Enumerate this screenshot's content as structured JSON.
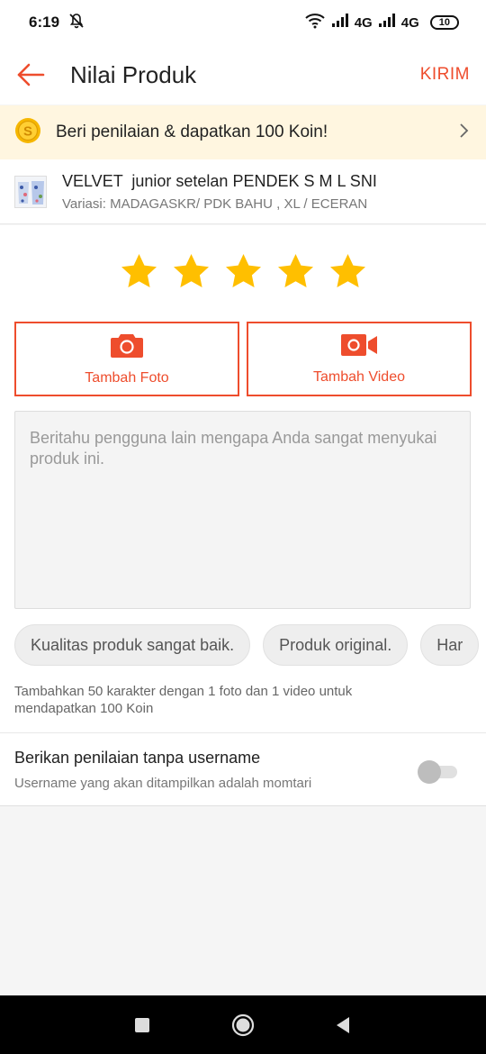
{
  "status_bar": {
    "time": "6:19",
    "network_1": "4G",
    "network_2": "4G",
    "battery": "10",
    "icons": [
      "mute-icon",
      "wifi-icon",
      "signal-icon",
      "battery-icon"
    ]
  },
  "app_bar": {
    "title": "Nilai Produk",
    "submit_label": "KIRIM",
    "back_icon": "back-arrow-icon"
  },
  "coin_banner": {
    "text": "Beri penilaian & dapatkan 100 Koin!",
    "coin_symbol": "S",
    "icon": "coin-icon"
  },
  "product": {
    "name": "VELVET  junior setelan PENDEK S M L SNI",
    "variant": "Variasi: MADAGASKR/ PDK BAHU , XL / ECERAN"
  },
  "rating": {
    "stars": 5,
    "max": 5,
    "color": "#ffbf00"
  },
  "media": {
    "photo_label": "Tambah Foto",
    "video_label": "Tambah Video",
    "accent": "#ee4d2d"
  },
  "review": {
    "placeholder": "Beritahu pengguna lain mengapa Anda sangat menyukai produk ini."
  },
  "chips": [
    "Kualitas produk sangat baik.",
    "Produk original.",
    "Har"
  ],
  "hint": "Tambahkan 50 karakter dengan 1 foto dan 1 video untuk mendapatkan 100 Koin",
  "anonymous": {
    "title": "Berikan penilaian tanpa username",
    "description": "Username yang akan ditampilkan adalah momtari",
    "enabled": false
  }
}
